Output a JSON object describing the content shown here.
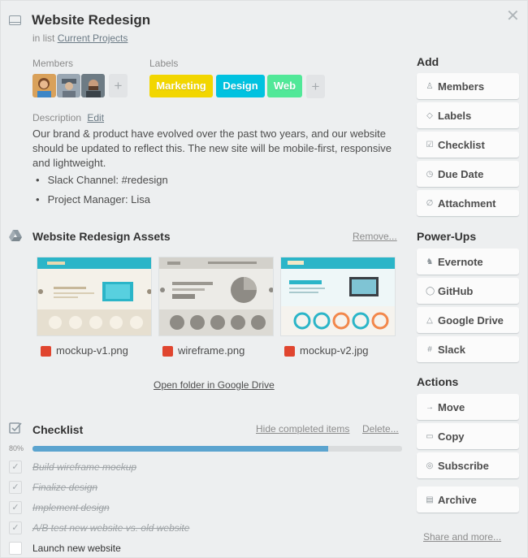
{
  "card": {
    "title": "Website Redesign",
    "list_prefix": "in list",
    "list_name": "Current Projects",
    "close_glyph": "✕"
  },
  "members": {
    "heading": "Members",
    "avatars": [
      "avatar-woman",
      "avatar-man-cap",
      "avatar-man-beard"
    ],
    "add_glyph": "+"
  },
  "labels": {
    "heading": "Labels",
    "items": [
      {
        "text": "Marketing",
        "color": "#f2d600"
      },
      {
        "text": "Design",
        "color": "#00c2e0"
      },
      {
        "text": "Web",
        "color": "#51e898"
      }
    ],
    "add_glyph": "+"
  },
  "description": {
    "heading": "Description",
    "edit_label": "Edit",
    "text": "Our brand & product have evolved over the past two years, and our website should be updated to reflect this. The new site will be mobile-first, responsive and lightweight.",
    "bullets": [
      "Slack Channel: #redesign",
      "Project Manager: Lisa"
    ]
  },
  "assets": {
    "title": "Website Redesign Assets",
    "remove_label": "Remove...",
    "files": [
      {
        "name": "mockup-v1.png"
      },
      {
        "name": "wireframe.png"
      },
      {
        "name": "mockup-v2.jpg"
      }
    ],
    "open_folder": "Open folder in Google Drive"
  },
  "checklist": {
    "title": "Checklist",
    "hide_label": "Hide completed items",
    "delete_label": "Delete...",
    "percent_label": "80%",
    "progress": 0.8,
    "items": [
      {
        "text": "Build wireframe mockup",
        "done": true
      },
      {
        "text": "Finalize design",
        "done": true
      },
      {
        "text": "Implement design",
        "done": true
      },
      {
        "text": "A/B test new website vs. old website",
        "done": true
      },
      {
        "text": "Launch new website",
        "done": false
      }
    ]
  },
  "sidebar": {
    "add_heading": "Add",
    "add_buttons": [
      {
        "label": "Members",
        "icon": "person-icon"
      },
      {
        "label": "Labels",
        "icon": "tag-icon"
      },
      {
        "label": "Checklist",
        "icon": "checkbox-icon"
      },
      {
        "label": "Due Date",
        "icon": "clock-icon"
      },
      {
        "label": "Attachment",
        "icon": "paperclip-icon"
      }
    ],
    "powerups_heading": "Power-Ups",
    "powerup_buttons": [
      {
        "label": "Evernote",
        "icon": "evernote-icon"
      },
      {
        "label": "GitHub",
        "icon": "github-icon"
      },
      {
        "label": "Google Drive",
        "icon": "google-drive-icon"
      },
      {
        "label": "Slack",
        "icon": "slack-icon"
      }
    ],
    "actions_heading": "Actions",
    "action_buttons": [
      {
        "label": "Move",
        "icon": "arrow-right-icon"
      },
      {
        "label": "Copy",
        "icon": "copy-icon"
      },
      {
        "label": "Subscribe",
        "icon": "eye-icon"
      },
      {
        "label": "Archive",
        "icon": "archive-icon"
      }
    ],
    "share_label": "Share and more..."
  }
}
